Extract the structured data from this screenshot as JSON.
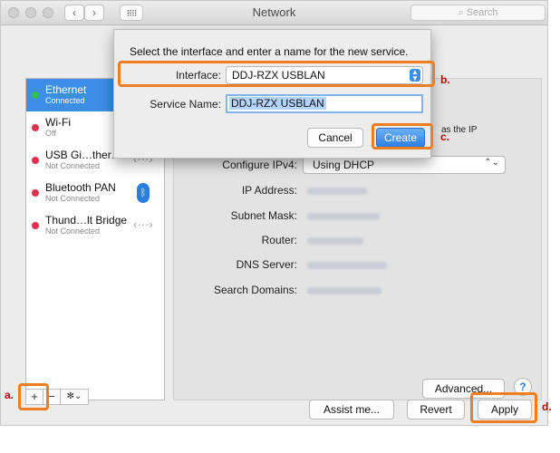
{
  "window": {
    "title": "Network",
    "search_placeholder": "Search"
  },
  "sidebar": {
    "items": [
      {
        "name": "Ethernet",
        "status": "Connected",
        "dot": "#2fc24a"
      },
      {
        "name": "Wi-Fi",
        "status": "Off",
        "dot": "#e0314e"
      },
      {
        "name": "USB Gi…ther…t",
        "status": "Not Connected",
        "dot": "#e0314e"
      },
      {
        "name": "Bluetooth PAN",
        "status": "Not Connected",
        "dot": "#e0314e"
      },
      {
        "name": "Thund…lt Bridge",
        "status": "Not Connected",
        "dot": "#e0314e"
      }
    ],
    "add_label": "+",
    "remove_label": "−",
    "gear_label": "✻⌄"
  },
  "panel": {
    "partial_text": "as the IP",
    "configure_label": "Configure IPv4:",
    "configure_value": "Using DHCP",
    "fields": [
      {
        "label": "IP Address:"
      },
      {
        "label": "Subnet Mask:"
      },
      {
        "label": "Router:"
      },
      {
        "label": "DNS Server:"
      },
      {
        "label": "Search Domains:"
      }
    ],
    "advanced_label": "Advanced...",
    "help_label": "?"
  },
  "bottom": {
    "assist_label": "Assist me...",
    "revert_label": "Revert",
    "apply_label": "Apply"
  },
  "sheet": {
    "instruction": "Select the interface and enter a name for the new service.",
    "interface_label": "Interface:",
    "interface_value": "DDJ-RZX USBLAN",
    "service_label": "Service Name:",
    "service_value": "DDJ-RZX USBLAN",
    "cancel_label": "Cancel",
    "create_label": "Create"
  },
  "callouts": {
    "a": "a.",
    "b": "b.",
    "c": "c.",
    "d": "d."
  },
  "colors": {
    "highlight": "#ef7d22",
    "callout": "#c00000",
    "accent": "#3d8ee6"
  }
}
